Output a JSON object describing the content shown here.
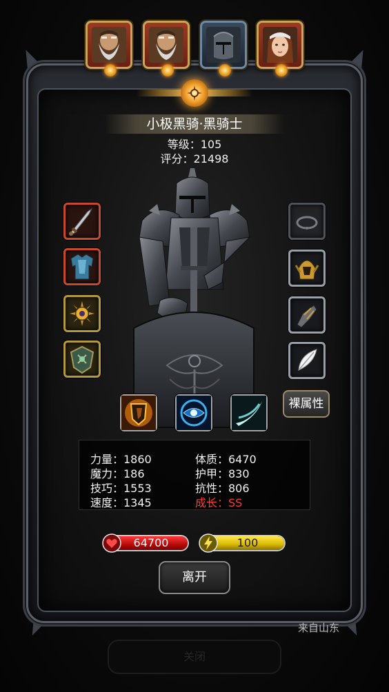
{
  "portraits": [
    {
      "name": "dwarf-elder-portrait",
      "selected": false
    },
    {
      "name": "dwarf-elder-portrait-2",
      "selected": false
    },
    {
      "name": "black-knight-portrait",
      "selected": true
    },
    {
      "name": "female-ranger-portrait",
      "selected": false
    }
  ],
  "hero": {
    "name": "小极黑骑·黑骑士",
    "level": "等级：105",
    "score": "评分：21498"
  },
  "equipment_left": [
    "greatsword-icon",
    "chest-armor-icon",
    "gold-sun-emblem-icon",
    "rune-shield-emblem-icon"
  ],
  "equipment_right": [
    "empty-ring-slot-icon",
    "golden-helm-icon",
    "gauntlet-icon",
    "white-feather-icon"
  ],
  "skills": [
    "flame-shield-skill-icon",
    "blue-eye-skill-icon",
    "wind-slash-skill-icon"
  ],
  "naked_attr_label": "裸属性",
  "stats": {
    "strength": "力量：1860",
    "constitution": "体质：6470",
    "magic": "魔力：186",
    "armor": "护甲：830",
    "skill": "技巧：1553",
    "resistance": "抗性：806",
    "speed": "速度：1345",
    "growth": "成长：SS"
  },
  "hp": {
    "value": "64700",
    "fill_fraction": 1.0
  },
  "energy": {
    "value": "100",
    "fill_fraction": 1.0
  },
  "leave_label": "离开",
  "source_label": "来自山东",
  "background_button_label": "关闭",
  "colors": {
    "growth_text": "#ff3b2e",
    "hp_bar": "#d81414",
    "energy_bar": "#e8c800",
    "gold_accent": "#c9a45a"
  }
}
